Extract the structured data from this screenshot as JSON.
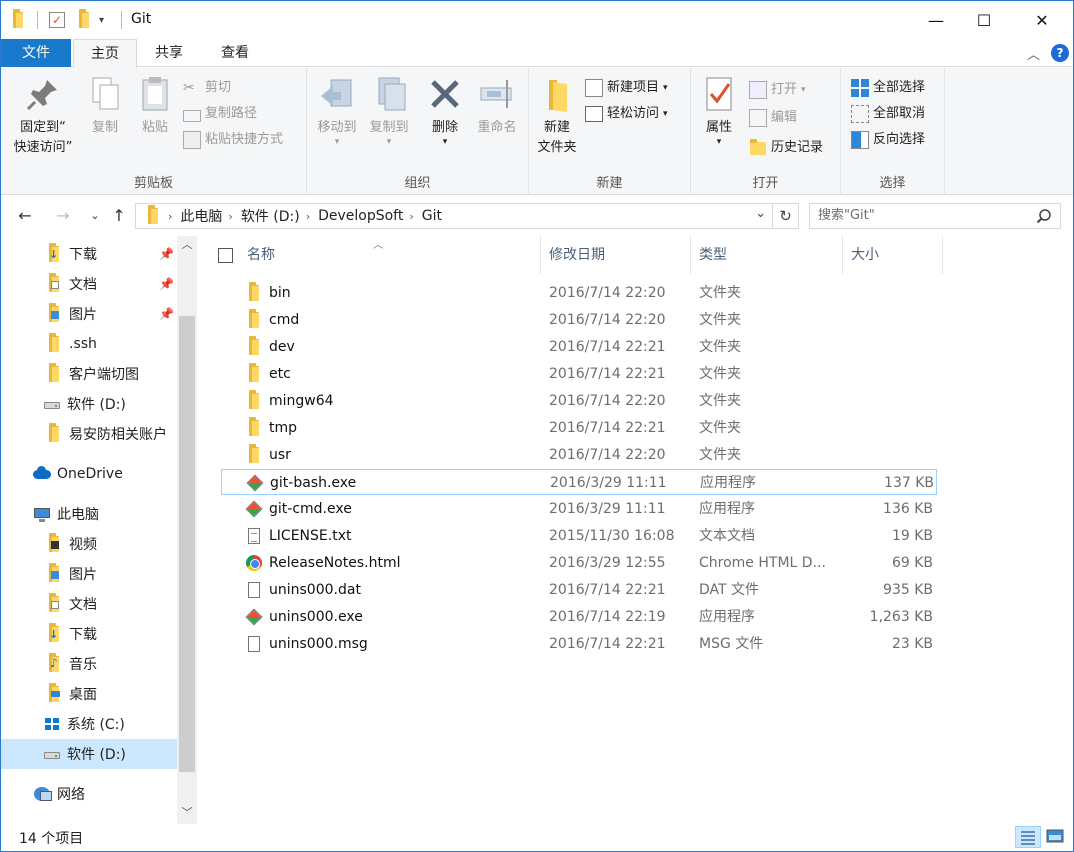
{
  "window": {
    "title": "Git",
    "controls": {
      "minimize": "—",
      "maximize": "☐",
      "close": "✕"
    }
  },
  "ribbon": {
    "tabs": [
      {
        "label": "文件",
        "active": false
      },
      {
        "label": "主页",
        "active": true
      },
      {
        "label": "共享",
        "active": false
      },
      {
        "label": "查看",
        "active": false
      }
    ],
    "help": "?",
    "collapse": "︿",
    "groups": {
      "clipboard": {
        "label": "剪贴板",
        "pin_line1": "固定到“",
        "pin_line2": "快速访问”",
        "copy": "复制",
        "paste": "粘贴",
        "cut": "剪切",
        "copy_path": "复制路径",
        "paste_shortcut": "粘贴快捷方式"
      },
      "organize": {
        "label": "组织",
        "move_to": "移动到",
        "copy_to": "复制到",
        "delete": "删除",
        "rename": "重命名"
      },
      "new": {
        "label": "新建",
        "new_folder_line1": "新建",
        "new_folder_line2": "文件夹",
        "new_item": "新建项目",
        "easy_access": "轻松访问"
      },
      "open": {
        "label": "打开",
        "properties": "属性",
        "open": "打开",
        "edit": "编辑",
        "history": "历史记录"
      },
      "select": {
        "label": "选择",
        "select_all": "全部选择",
        "select_none": "全部取消",
        "invert": "反向选择"
      }
    }
  },
  "address": {
    "crumbs": [
      "此电脑",
      "软件 (D:)",
      "DevelopSoft",
      "Git"
    ],
    "search_placeholder": "搜索\"Git\""
  },
  "nav": {
    "items": [
      {
        "label": "下载",
        "icon": "download-folder-icon",
        "pinned": true
      },
      {
        "label": "文档",
        "icon": "documents-folder-icon",
        "pinned": true
      },
      {
        "label": "图片",
        "icon": "pictures-folder-icon",
        "pinned": true
      },
      {
        "label": ".ssh",
        "icon": "folder-icon",
        "pinned": false
      },
      {
        "label": "客户端切图",
        "icon": "folder-icon",
        "pinned": false
      },
      {
        "label": "软件 (D:)",
        "icon": "drive-icon",
        "pinned": false
      },
      {
        "label": "易安防相关账户",
        "icon": "folder-icon",
        "pinned": false
      },
      {
        "label": "OneDrive",
        "icon": "onedrive-icon",
        "pinned": false
      },
      {
        "label": "此电脑",
        "icon": "computer-icon",
        "pinned": false
      },
      {
        "label": "视频",
        "icon": "videos-folder-icon",
        "pinned": false
      },
      {
        "label": "图片",
        "icon": "pictures-folder-icon",
        "pinned": false
      },
      {
        "label": "文档",
        "icon": "documents-folder-icon",
        "pinned": false
      },
      {
        "label": "下载",
        "icon": "download-folder-icon",
        "pinned": false
      },
      {
        "label": "音乐",
        "icon": "music-folder-icon",
        "pinned": false
      },
      {
        "label": "桌面",
        "icon": "desktop-folder-icon",
        "pinned": false
      },
      {
        "label": "系统 (C:)",
        "icon": "windows-drive-icon",
        "pinned": false
      },
      {
        "label": "软件 (D:)",
        "icon": "drive-icon",
        "pinned": false,
        "selected": true
      },
      {
        "label": "网络",
        "icon": "network-icon",
        "pinned": false
      }
    ]
  },
  "columns": {
    "name": "名称",
    "date": "修改日期",
    "type": "类型",
    "size": "大小"
  },
  "files": [
    {
      "name": "bin",
      "date": "2016/7/14 22:20",
      "type": "文件夹",
      "size": "",
      "icon": "folder-icon"
    },
    {
      "name": "cmd",
      "date": "2016/7/14 22:20",
      "type": "文件夹",
      "size": "",
      "icon": "folder-icon"
    },
    {
      "name": "dev",
      "date": "2016/7/14 22:21",
      "type": "文件夹",
      "size": "",
      "icon": "folder-icon"
    },
    {
      "name": "etc",
      "date": "2016/7/14 22:21",
      "type": "文件夹",
      "size": "",
      "icon": "folder-icon"
    },
    {
      "name": "mingw64",
      "date": "2016/7/14 22:20",
      "type": "文件夹",
      "size": "",
      "icon": "folder-icon"
    },
    {
      "name": "tmp",
      "date": "2016/7/14 22:21",
      "type": "文件夹",
      "size": "",
      "icon": "folder-icon"
    },
    {
      "name": "usr",
      "date": "2016/7/14 22:20",
      "type": "文件夹",
      "size": "",
      "icon": "folder-icon"
    },
    {
      "name": "git-bash.exe",
      "date": "2016/3/29 11:11",
      "type": "应用程序",
      "size": "137 KB",
      "icon": "git-icon",
      "focused": true
    },
    {
      "name": "git-cmd.exe",
      "date": "2016/3/29 11:11",
      "type": "应用程序",
      "size": "136 KB",
      "icon": "git-icon"
    },
    {
      "name": "LICENSE.txt",
      "date": "2015/11/30 16:08",
      "type": "文本文档",
      "size": "19 KB",
      "icon": "text-file-icon"
    },
    {
      "name": "ReleaseNotes.html",
      "date": "2016/3/29 12:55",
      "type": "Chrome HTML D...",
      "size": "69 KB",
      "icon": "chrome-icon"
    },
    {
      "name": "unins000.dat",
      "date": "2016/7/14 22:21",
      "type": "DAT 文件",
      "size": "935 KB",
      "icon": "file-icon"
    },
    {
      "name": "unins000.exe",
      "date": "2016/7/14 22:19",
      "type": "应用程序",
      "size": "1,263 KB",
      "icon": "git-icon"
    },
    {
      "name": "unins000.msg",
      "date": "2016/7/14 22:21",
      "type": "MSG 文件",
      "size": "23 KB",
      "icon": "file-icon"
    }
  ],
  "status": {
    "count": "14 个项目"
  }
}
